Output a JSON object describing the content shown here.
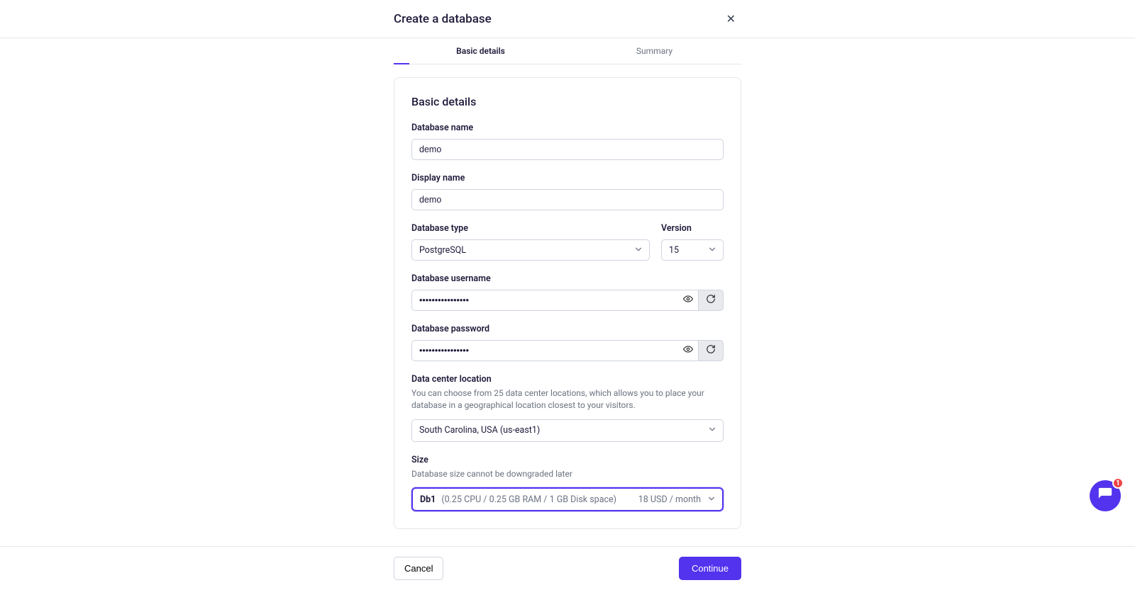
{
  "colors": {
    "primary": "#5333ed"
  },
  "header": {
    "title": "Create a database"
  },
  "tabs": [
    {
      "label": "Basic details",
      "active": true
    },
    {
      "label": "Summary",
      "active": false
    }
  ],
  "section": {
    "title": "Basic details"
  },
  "fields": {
    "db_name": {
      "label": "Database name",
      "value": "demo"
    },
    "display_name": {
      "label": "Display name",
      "value": "demo"
    },
    "db_type": {
      "label": "Database type",
      "value": "PostgreSQL"
    },
    "version": {
      "label": "Version",
      "value": "15"
    },
    "db_user": {
      "label": "Database username",
      "value": "••••••••••••••••"
    },
    "db_pass": {
      "label": "Database password",
      "value": "••••••••••••••••"
    },
    "location": {
      "label": "Data center location",
      "help": "You can choose from 25 data center locations, which allows you to place your database in a geographical location closest to your visitors.",
      "value": "South Carolina, USA (us-east1)"
    },
    "size": {
      "label": "Size",
      "help": "Database size cannot be downgraded later",
      "name": "Db1",
      "spec": "(0.25 CPU / 0.25 GB RAM / 1 GB Disk space)",
      "price": "18 USD / month"
    }
  },
  "footer": {
    "cancel": "Cancel",
    "continue": "Continue"
  },
  "chat": {
    "badge": "1"
  }
}
